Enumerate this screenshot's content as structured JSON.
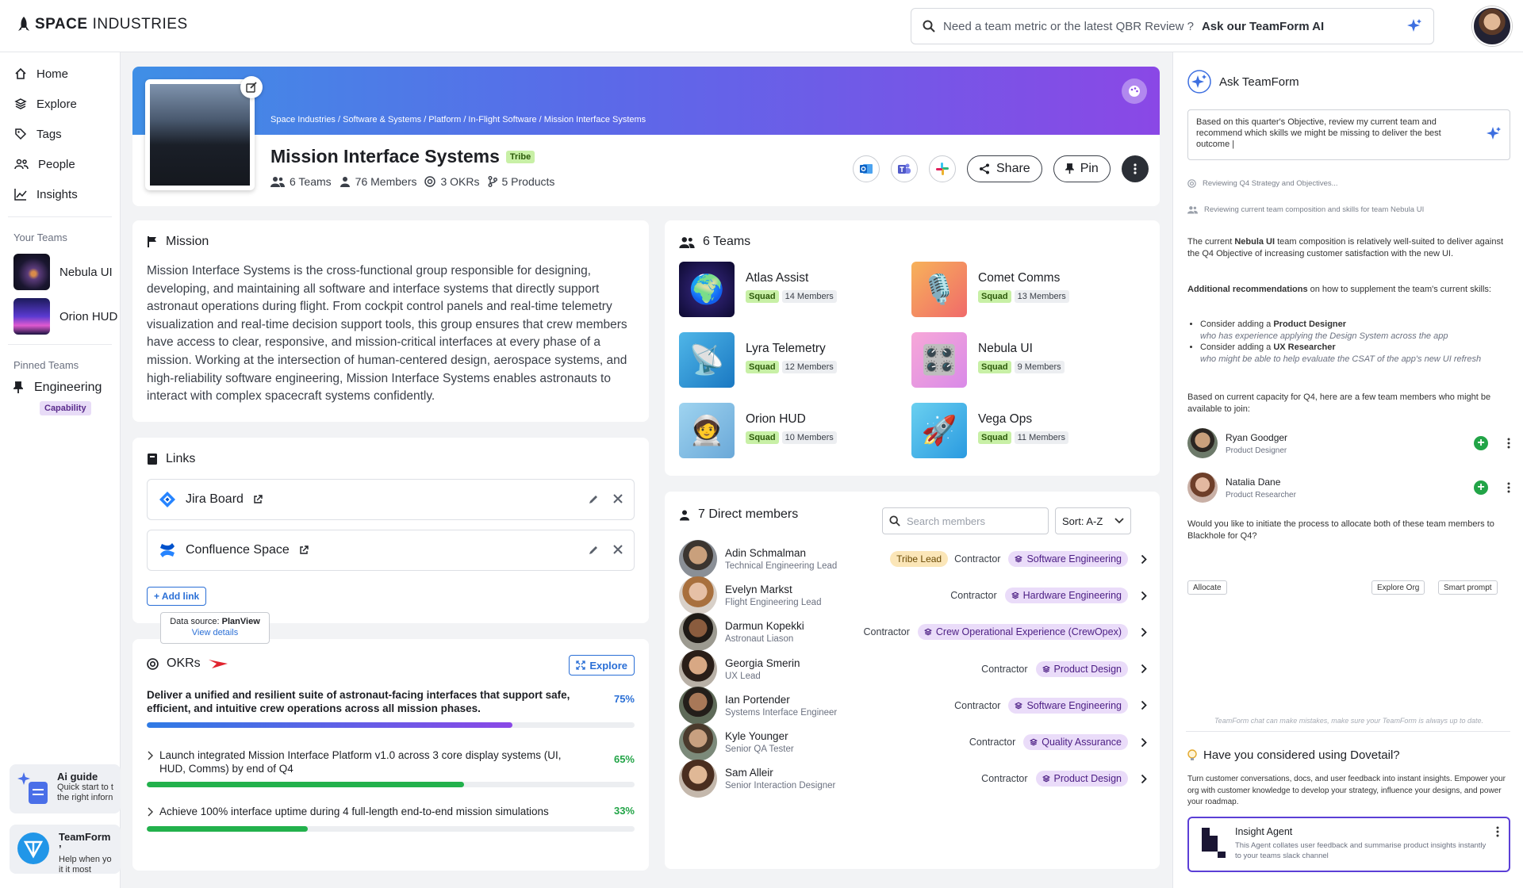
{
  "brand": {
    "bold": "SPACE",
    "light": "INDUSTRIES"
  },
  "top_search": {
    "prefix": "Need a team metric or the latest QBR Review ?",
    "strong": "Ask our TeamForm AI"
  },
  "nav": [
    "Home",
    "Explore",
    "Tags",
    "People",
    "Insights"
  ],
  "your_teams": {
    "label": "Your Teams",
    "items": [
      "Nebula UI",
      "Orion HUD"
    ]
  },
  "pinned": {
    "label": "Pinned Teams",
    "name": "Engineering",
    "badge": "Capability"
  },
  "promo_guide": {
    "title": "Ai guide",
    "line1": "Quick start to t",
    "line2": "the right inforn"
  },
  "promo_tf": {
    "title": "TeamForm ’",
    "line1": "Help when yo",
    "line2": "it it most"
  },
  "banner": {
    "breadcrumb": "Space Industries / Software & Systems / Platform / In-Flight Software / Mission Interface Systems",
    "title": "Mission Interface Systems",
    "tag": "Tribe",
    "stats": {
      "teams": "6 Teams",
      "members": "76 Members",
      "okrs": "3 OKRs",
      "products": "5 Products"
    },
    "share": "Share",
    "pin": "Pin"
  },
  "mission": {
    "title": "Mission",
    "text": "Mission Interface Systems is the cross-functional group responsible for designing, developing, and maintaining all software and interface systems that directly support astronaut operations during flight. From cockpit control panels and real-time telemetry visualization and real-time decision support tools, this group ensures that crew members have access to clear, responsive, and mission-critical interfaces at every phase of a mission. Working at the intersection of human-centered design, aerospace systems, and high-reliability software engineering, Mission Interface Systems enables astronauts to interact with complex spacecraft systems confidently."
  },
  "links": {
    "title": "Links",
    "items": [
      "Jira Board",
      "Confluence Space"
    ],
    "add": "+ Add link"
  },
  "tooltip": {
    "label": "Data source:",
    "source": "PlanView",
    "link": "View details"
  },
  "okrs": {
    "title": "OKRs",
    "explore": "Explore",
    "main": {
      "text": "Deliver a unified and resilient suite of astronaut-facing interfaces that support safe, efficient, and intuitive crew operations across all mission phases.",
      "pct": "75%",
      "value": 0.75
    },
    "subs": [
      {
        "text": "Launch integrated Mission Interface Platform v1.0 across 3 core display systems (UI, HUD, Comms) by end of Q4",
        "pct": "65%",
        "value": 0.65
      },
      {
        "text": "Achieve 100% interface uptime during 4 full-length end-to-end mission simulations",
        "pct": "33%",
        "value": 0.33
      }
    ],
    "colors": {
      "main_start": "#2f7be5",
      "main_end": "#8a48e6",
      "sub": "#22b14c",
      "pct_main": "#2a6fd6",
      "pct_sub": "#22a447"
    }
  },
  "teams": {
    "title": "6 Teams",
    "items": [
      {
        "name": "Atlas Assist",
        "type": "Squad",
        "members": "14 Members",
        "icon": "🌍"
      },
      {
        "name": "Comet Comms",
        "type": "Squad",
        "members": "13 Members",
        "icon": "🎙️"
      },
      {
        "name": "Lyra Telemetry",
        "type": "Squad",
        "members": "12 Members",
        "icon": "📡"
      },
      {
        "name": "Nebula UI",
        "type": "Squad",
        "members": "9 Members",
        "icon": "🎛️"
      },
      {
        "name": "Orion HUD",
        "type": "Squad",
        "members": "10 Members",
        "icon": "🧑‍🚀"
      },
      {
        "name": "Vega Ops",
        "type": "Squad",
        "members": "11 Members",
        "icon": "🚀"
      }
    ]
  },
  "direct": {
    "title": "7 Direct members",
    "search_placeholder": "Search members",
    "sort": "Sort: A-Z",
    "members": [
      {
        "name": "Adin Schmalman",
        "role": "Technical Engineering Lead",
        "lead": "Tribe Lead",
        "contract": "Contractor",
        "area": "Software Engineering"
      },
      {
        "name": "Evelyn Markst",
        "role": "Flight Engineering Lead",
        "lead": "",
        "contract": "Contractor",
        "area": "Hardware Engineering"
      },
      {
        "name": "Darmun Kopekki",
        "role": "Astronaut Liason",
        "lead": "",
        "contract": "Contractor",
        "area": "Crew Operational Experience (CrewOpex)"
      },
      {
        "name": "Georgia Smerin",
        "role": "UX Lead",
        "lead": "",
        "contract": "Contractor",
        "area": "Product Design"
      },
      {
        "name": "Ian Portender",
        "role": "Systems Interface Engineer",
        "lead": "",
        "contract": "Contractor",
        "area": "Software Engineering"
      },
      {
        "name": "Kyle Younger",
        "role": "Senior QA Tester",
        "lead": "",
        "contract": "Contractor",
        "area": "Quality Assurance"
      },
      {
        "name": "Sam Alleir",
        "role": "Senior Interaction Designer",
        "lead": "",
        "contract": "Contractor",
        "area": "Product Design"
      }
    ]
  },
  "ask": {
    "title": "Ask TeamForm",
    "prompt": "Based on this quarter's Objective, review my current team and recommend which skills we might be missing to deliver the best outcome |",
    "steps": [
      "Reviewing Q4 Strategy and Objectives...",
      "Reviewing current team composition and skills for team Nebula UI"
    ],
    "resp1_a": "The current ",
    "resp1_b": "Nebula UI",
    "resp1_c": " team composition is relatively well-suited to deliver against the Q4 Objective of increasing customer satisfaction with the new UI.",
    "resp2_a": "Additional recommendations",
    "resp2_b": " on how to supplement the team's current skills:",
    "rec1_a": "Consider adding a ",
    "rec1_b": "Product Designer",
    "rec1_c": "who has experience applying the Design System across the app",
    "rec2_a": "Consider adding a ",
    "rec2_b": "UX Researcher",
    "rec2_c": "who might be able to help evaluate the CSAT of the app's new UI refresh",
    "resp3": "Based on current capacity for Q4, here are a few team members who might be available to join:",
    "people": [
      {
        "name": "Ryan Goodger",
        "role": "Product Designer"
      },
      {
        "name": "Natalia Dane",
        "role": "Product Researcher"
      }
    ],
    "resp4": "Would you like to initiate the process to allocate both of these team members to Blackhole for Q4?",
    "allocate": "Allocate",
    "explore_org": "Explore Org",
    "smart": "Smart prompt",
    "disclaimer": "TeamForm chat can make mistakes, make sure your TeamForm is always up to date."
  },
  "dovetail": {
    "title": "Have you considered using Dovetail?",
    "text": "Turn customer conversations, docs, and user feedback into instant insights. Empower your org with customer knowledge to develop your strategy, influence your designs, and power your roadmap.",
    "agent_name": "Insight Agent",
    "agent_desc": "This Agent collates user feedback and summarise product insights instantly to your teams slack channel"
  }
}
